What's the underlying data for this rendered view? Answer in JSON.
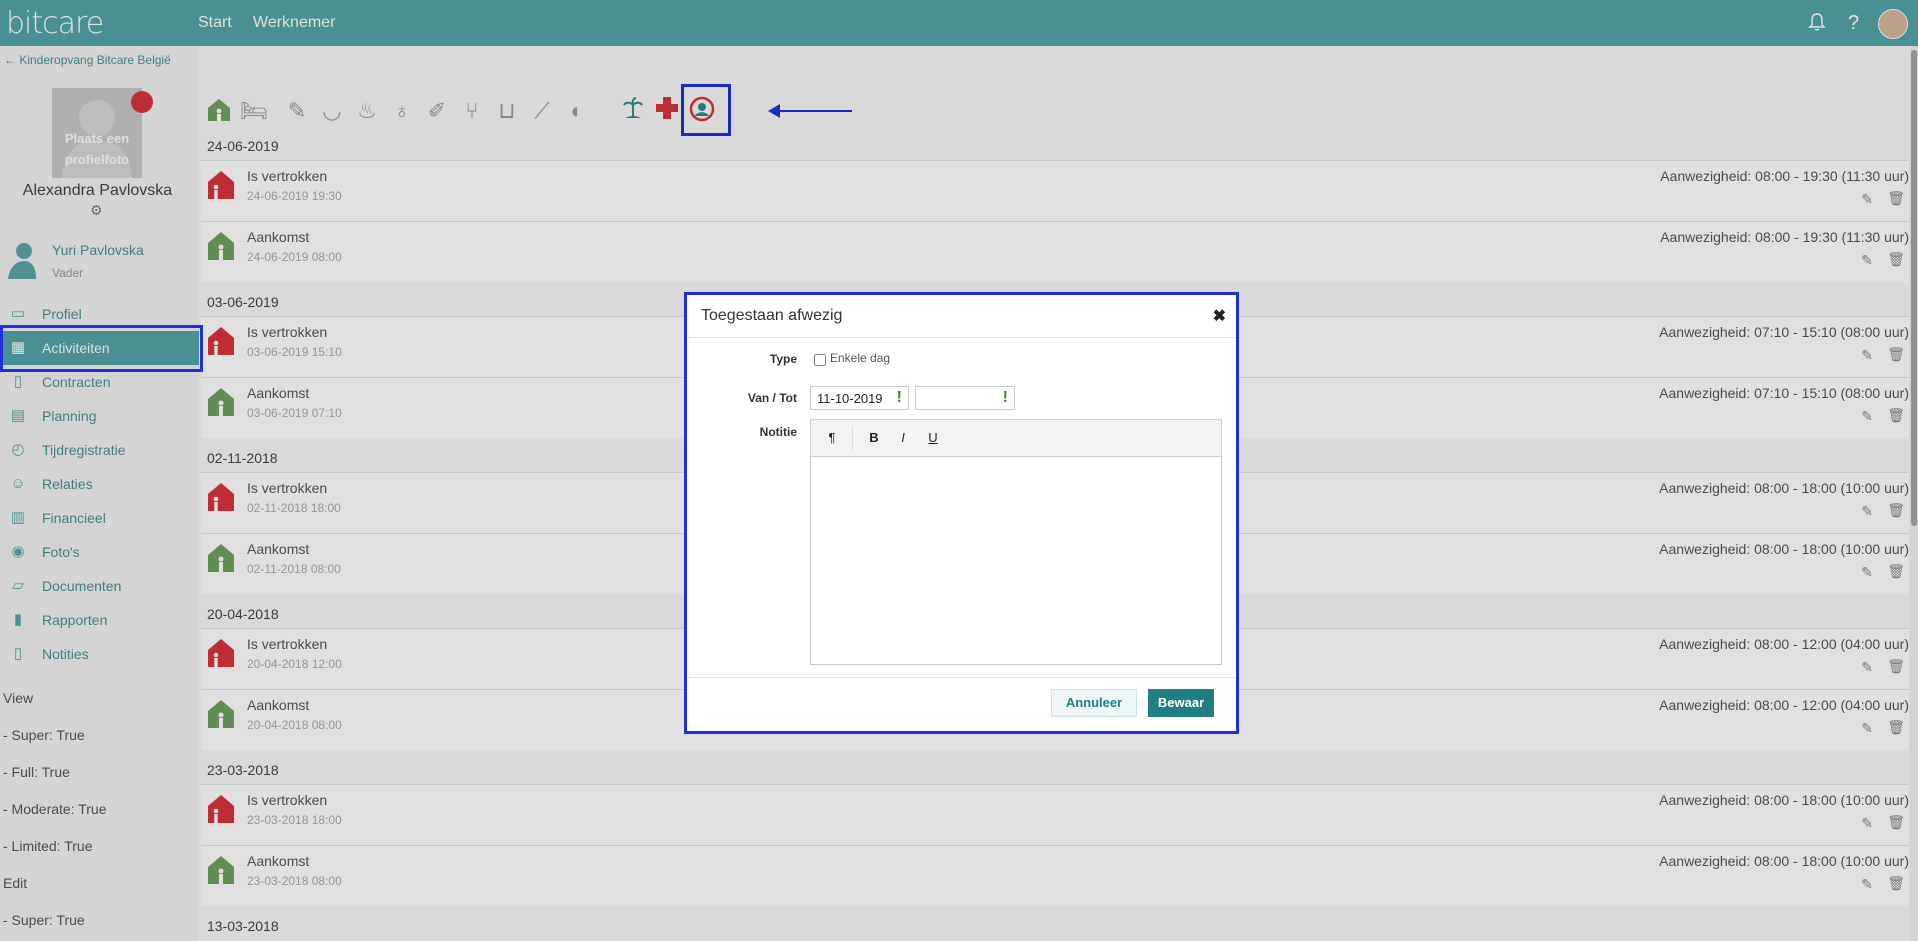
{
  "topbar": {
    "logo": "bitcare",
    "nav": [
      "Start",
      "Werknemer"
    ],
    "help": "?"
  },
  "sidebar": {
    "back_link": "← Kinderopvang Bitcare België",
    "photo_text": "Plaats een profielfoto",
    "child_name": "Alexandra Pavlovska",
    "parent_name": "Yuri Pavlovska",
    "parent_role": "Vader",
    "menu": [
      {
        "label": "Profiel",
        "icon": "id-card-icon"
      },
      {
        "label": "Activiteiten",
        "icon": "table-icon"
      },
      {
        "label": "Contracten",
        "icon": "contract-icon"
      },
      {
        "label": "Planning",
        "icon": "calendar-icon"
      },
      {
        "label": "Tijdregistratie",
        "icon": "stopwatch-icon"
      },
      {
        "label": "Relaties",
        "icon": "people-icon"
      },
      {
        "label": "Financieel",
        "icon": "bar-chart-icon"
      },
      {
        "label": "Foto's",
        "icon": "camera-icon"
      },
      {
        "label": "Documenten",
        "icon": "folder-icon"
      },
      {
        "label": "Rapporten",
        "icon": "report-icon"
      },
      {
        "label": "Notities",
        "icon": "clipboard-icon"
      }
    ],
    "permissions": [
      "View",
      "- Super: True",
      "- Full: True",
      "- Moderate: True",
      "- Limited: True",
      "Edit",
      "- Super: True"
    ]
  },
  "toolbar_icons": [
    "arrival-house-icon",
    "bed-icon",
    "notes-icon",
    "diaper-icon",
    "potty-icon",
    "bottle-icon",
    "medicine-icon",
    "meal-icon",
    "drink-icon",
    "brush-icon",
    "ball-icon",
    "vacation-icon",
    "red-cross-icon",
    "excused-absent-icon"
  ],
  "days": [
    {
      "date": "24-06-2019",
      "entries": [
        {
          "kind": "departure",
          "title": "Is vertrokken",
          "time": "24-06-2019 19:30",
          "presence": "Aanwezigheid: 08:00 - 19:30 (11:30 uur)"
        },
        {
          "kind": "arrival",
          "title": "Aankomst",
          "time": "24-06-2019 08:00",
          "presence": "Aanwezigheid: 08:00 - 19:30 (11:30 uur)"
        }
      ]
    },
    {
      "date": "03-06-2019",
      "entries": [
        {
          "kind": "departure",
          "title": "Is vertrokken",
          "time": "03-06-2019 15:10",
          "presence": "Aanwezigheid: 07:10 - 15:10 (08:00 uur)"
        },
        {
          "kind": "arrival",
          "title": "Aankomst",
          "time": "03-06-2019 07:10",
          "presence": "Aanwezigheid: 07:10 - 15:10 (08:00 uur)"
        }
      ]
    },
    {
      "date": "02-11-2018",
      "entries": [
        {
          "kind": "departure",
          "title": "Is vertrokken",
          "time": "02-11-2018 18:00",
          "presence": "Aanwezigheid: 08:00 - 18:00 (10:00 uur)"
        },
        {
          "kind": "arrival",
          "title": "Aankomst",
          "time": "02-11-2018 08:00",
          "presence": "Aanwezigheid: 08:00 - 18:00 (10:00 uur)"
        }
      ]
    },
    {
      "date": "20-04-2018",
      "entries": [
        {
          "kind": "departure",
          "title": "Is vertrokken",
          "time": "20-04-2018 12:00",
          "presence": "Aanwezigheid: 08:00 - 12:00 (04:00 uur)"
        },
        {
          "kind": "arrival",
          "title": "Aankomst",
          "time": "20-04-2018 08:00",
          "presence": "Aanwezigheid: 08:00 - 12:00 (04:00 uur)"
        }
      ]
    },
    {
      "date": "23-03-2018",
      "entries": [
        {
          "kind": "departure",
          "title": "Is vertrokken",
          "time": "23-03-2018 18:00",
          "presence": "Aanwezigheid: 08:00 - 18:00 (10:00 uur)"
        },
        {
          "kind": "arrival",
          "title": "Aankomst",
          "time": "23-03-2018 08:00",
          "presence": "Aanwezigheid: 08:00 - 18:00 (10:00 uur)"
        }
      ]
    },
    {
      "date": "13-03-2018",
      "entries": []
    }
  ],
  "modal": {
    "title": "Toegestaan afwezig",
    "type_label": "Type",
    "single_day_label": "Enkele dag",
    "single_day_checked": false,
    "period_label": "Van / Tot",
    "from_value": "11-10-2019",
    "to_value": "",
    "warning_mark": "!",
    "note_label": "Notitie",
    "editor_buttons": {
      "paragraph": "¶",
      "bold": "B",
      "italic": "I",
      "underline": "U"
    },
    "cancel_label": "Annuleer",
    "save_label": "Bewaar"
  },
  "colors": {
    "teal": "#53a4a8",
    "departure": "#d9343c",
    "arrival": "#6fa35f",
    "highlight": "#1f2fe0"
  }
}
